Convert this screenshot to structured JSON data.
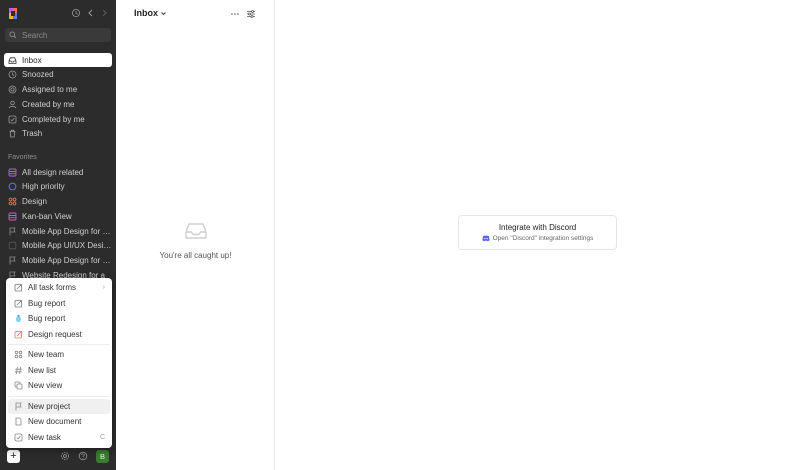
{
  "sidebar": {
    "search_placeholder": "Search",
    "nav": [
      {
        "label": "Inbox",
        "icon": "inbox-icon"
      },
      {
        "label": "Snoozed",
        "icon": "clock-icon"
      },
      {
        "label": "Assigned to me",
        "icon": "target-icon"
      },
      {
        "label": "Created by me",
        "icon": "user-icon"
      },
      {
        "label": "Completed by me",
        "icon": "check-square-icon"
      },
      {
        "label": "Trash",
        "icon": "trash-icon"
      }
    ],
    "favorites_title": "Favorites",
    "favorites": [
      {
        "label": "All design related",
        "icon": "view-icon",
        "color": "#c45be0"
      },
      {
        "label": "High priority",
        "icon": "circle-icon",
        "color": "#6b6bf2"
      },
      {
        "label": "Design",
        "icon": "team-icon",
        "color": "#f06e55"
      },
      {
        "label": "Kan-ban View",
        "icon": "view-icon",
        "color": "#c45be0"
      },
      {
        "label": "Mobile App Design for Seller",
        "icon": "flag-icon",
        "color": "#8e8e8e"
      },
      {
        "label": "Mobile App UI/UX Design",
        "icon": "square-icon",
        "color": "#8e8e8e"
      },
      {
        "label": "Mobile App Design for Buyer",
        "icon": "flag-icon",
        "color": "#8e8e8e"
      },
      {
        "label": "Website Redesign for a",
        "icon": "flag-icon",
        "color": "#8e8e8e"
      }
    ],
    "avatar_initial": "B"
  },
  "menu": {
    "groups": [
      [
        {
          "label": "All task forms",
          "icon": "form-icon",
          "right": "›"
        },
        {
          "label": "Bug report",
          "icon": "form-icon",
          "right": ""
        },
        {
          "label": "Bug report",
          "icon": "bug-icon",
          "right": ""
        },
        {
          "label": "Design request",
          "icon": "form-icon",
          "right": ""
        }
      ],
      [
        {
          "label": "New team",
          "icon": "team-icon",
          "right": ""
        },
        {
          "label": "New list",
          "icon": "hash-icon",
          "right": ""
        },
        {
          "label": "New view",
          "icon": "view-icon",
          "right": ""
        }
      ],
      [
        {
          "label": "New project",
          "icon": "flag-icon",
          "right": ""
        },
        {
          "label": "New document",
          "icon": "document-icon",
          "right": ""
        },
        {
          "label": "New task",
          "icon": "task-icon",
          "right": "C"
        }
      ]
    ]
  },
  "inbox": {
    "title": "Inbox",
    "empty_text": "You're all caught up!"
  },
  "discord": {
    "title": "Integrate with Discord",
    "subtitle": "Open \"Discord\" integration settings"
  },
  "colors": {
    "sidebar_bg": "#2c2c2c",
    "avatar_bg": "#3b7d2e",
    "discord": "#5865f2"
  }
}
